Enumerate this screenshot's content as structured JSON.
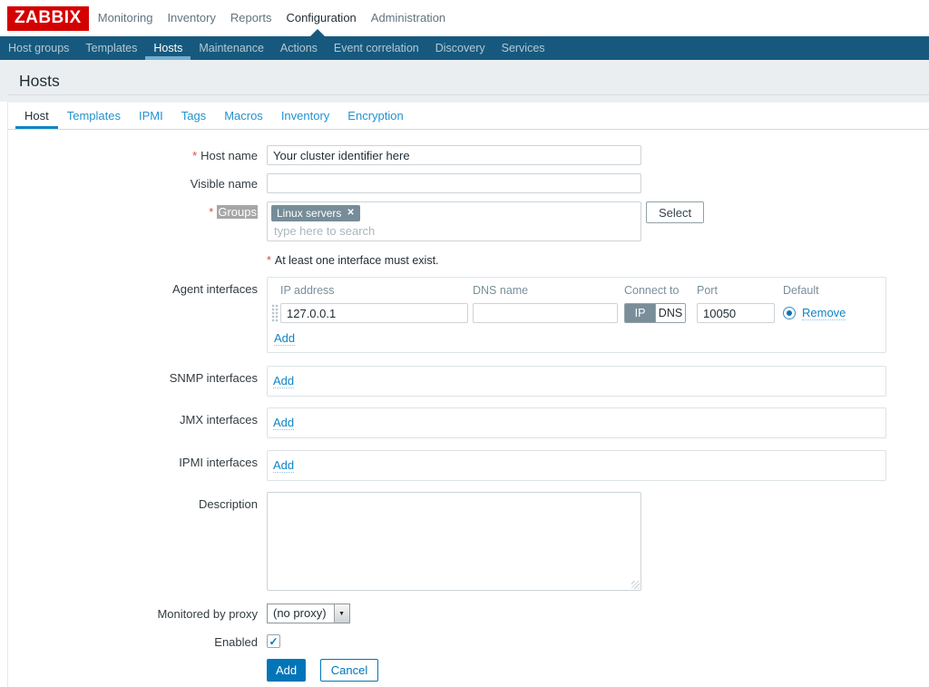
{
  "colors": {
    "brand_red": "#d40000",
    "nav_bar": "#17597e",
    "link_blue": "#0275b8",
    "chip_gray": "#768d99",
    "tab_underline": "#0e87c3"
  },
  "icons": {
    "close": "✕",
    "check": "✓",
    "dropdown_arrow": "▼"
  },
  "topnav": {
    "logo": "ZABBIX",
    "items": [
      {
        "label": "Monitoring",
        "active": false
      },
      {
        "label": "Inventory",
        "active": false
      },
      {
        "label": "Reports",
        "active": false
      },
      {
        "label": "Configuration",
        "active": true
      },
      {
        "label": "Administration",
        "active": false
      }
    ]
  },
  "subnav": {
    "items": [
      {
        "label": "Host groups",
        "active": false
      },
      {
        "label": "Templates",
        "active": false
      },
      {
        "label": "Hosts",
        "active": true
      },
      {
        "label": "Maintenance",
        "active": false
      },
      {
        "label": "Actions",
        "active": false
      },
      {
        "label": "Event correlation",
        "active": false
      },
      {
        "label": "Discovery",
        "active": false
      },
      {
        "label": "Services",
        "active": false
      }
    ]
  },
  "page": {
    "title": "Hosts"
  },
  "tabs": [
    {
      "label": "Host",
      "active": true
    },
    {
      "label": "Templates",
      "active": false
    },
    {
      "label": "IPMI",
      "active": false
    },
    {
      "label": "Tags",
      "active": false
    },
    {
      "label": "Macros",
      "active": false
    },
    {
      "label": "Inventory",
      "active": false
    },
    {
      "label": "Encryption",
      "active": false
    }
  ],
  "form": {
    "host_name": {
      "label": "Host name",
      "required": true,
      "value": "Your cluster identifier here"
    },
    "visible_name": {
      "label": "Visible name",
      "required": false,
      "value": ""
    },
    "groups": {
      "label": "Groups",
      "required": true,
      "chip": "Linux servers",
      "placeholder": "type here to search",
      "select_button": "Select"
    },
    "interface_note": "At least one interface must exist.",
    "agent": {
      "label": "Agent interfaces",
      "columns": {
        "ip": "IP address",
        "dns": "DNS name",
        "connect": "Connect to",
        "port": "Port",
        "default": "Default"
      },
      "row": {
        "ip": "127.0.0.1",
        "dns": "",
        "connect_options": [
          "IP",
          "DNS"
        ],
        "connect_selected": "IP",
        "port": "10050",
        "default": true,
        "remove_label": "Remove"
      },
      "add_label": "Add"
    },
    "snmp": {
      "label": "SNMP interfaces",
      "add_label": "Add"
    },
    "jmx": {
      "label": "JMX interfaces",
      "add_label": "Add"
    },
    "ipmi": {
      "label": "IPMI interfaces",
      "add_label": "Add"
    },
    "description": {
      "label": "Description",
      "value": ""
    },
    "proxy": {
      "label": "Monitored by proxy",
      "value": "(no proxy)"
    },
    "enabled": {
      "label": "Enabled",
      "checked": true
    },
    "footer": {
      "add_label": "Add",
      "cancel_label": "Cancel"
    }
  }
}
